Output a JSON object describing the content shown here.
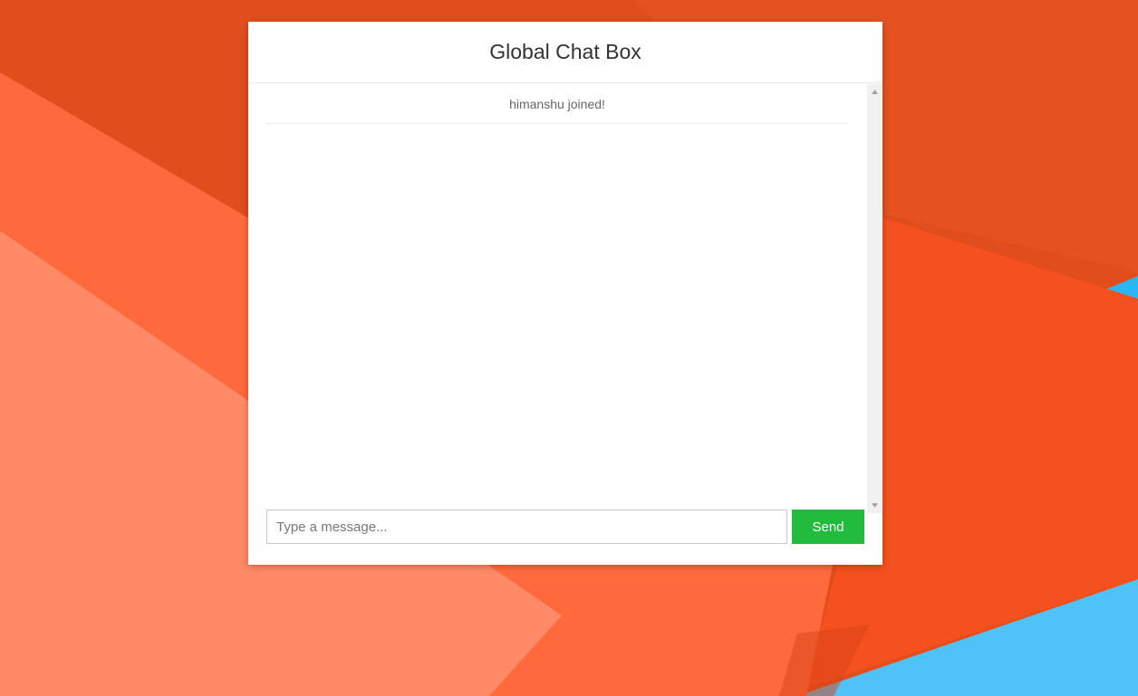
{
  "colors": {
    "accent": "#22bb3c",
    "background_primary": "#e24d1e",
    "background_secondary": "#4fc3f7"
  },
  "chat": {
    "title": "Global Chat Box",
    "messages": [
      {
        "type": "system",
        "text": "himanshu joined!"
      }
    ],
    "input": {
      "placeholder": "Type a message...",
      "value": ""
    },
    "send_label": "Send"
  },
  "scrollbar": {
    "up_icon": "triangle-up-icon",
    "down_icon": "triangle-down-icon"
  }
}
